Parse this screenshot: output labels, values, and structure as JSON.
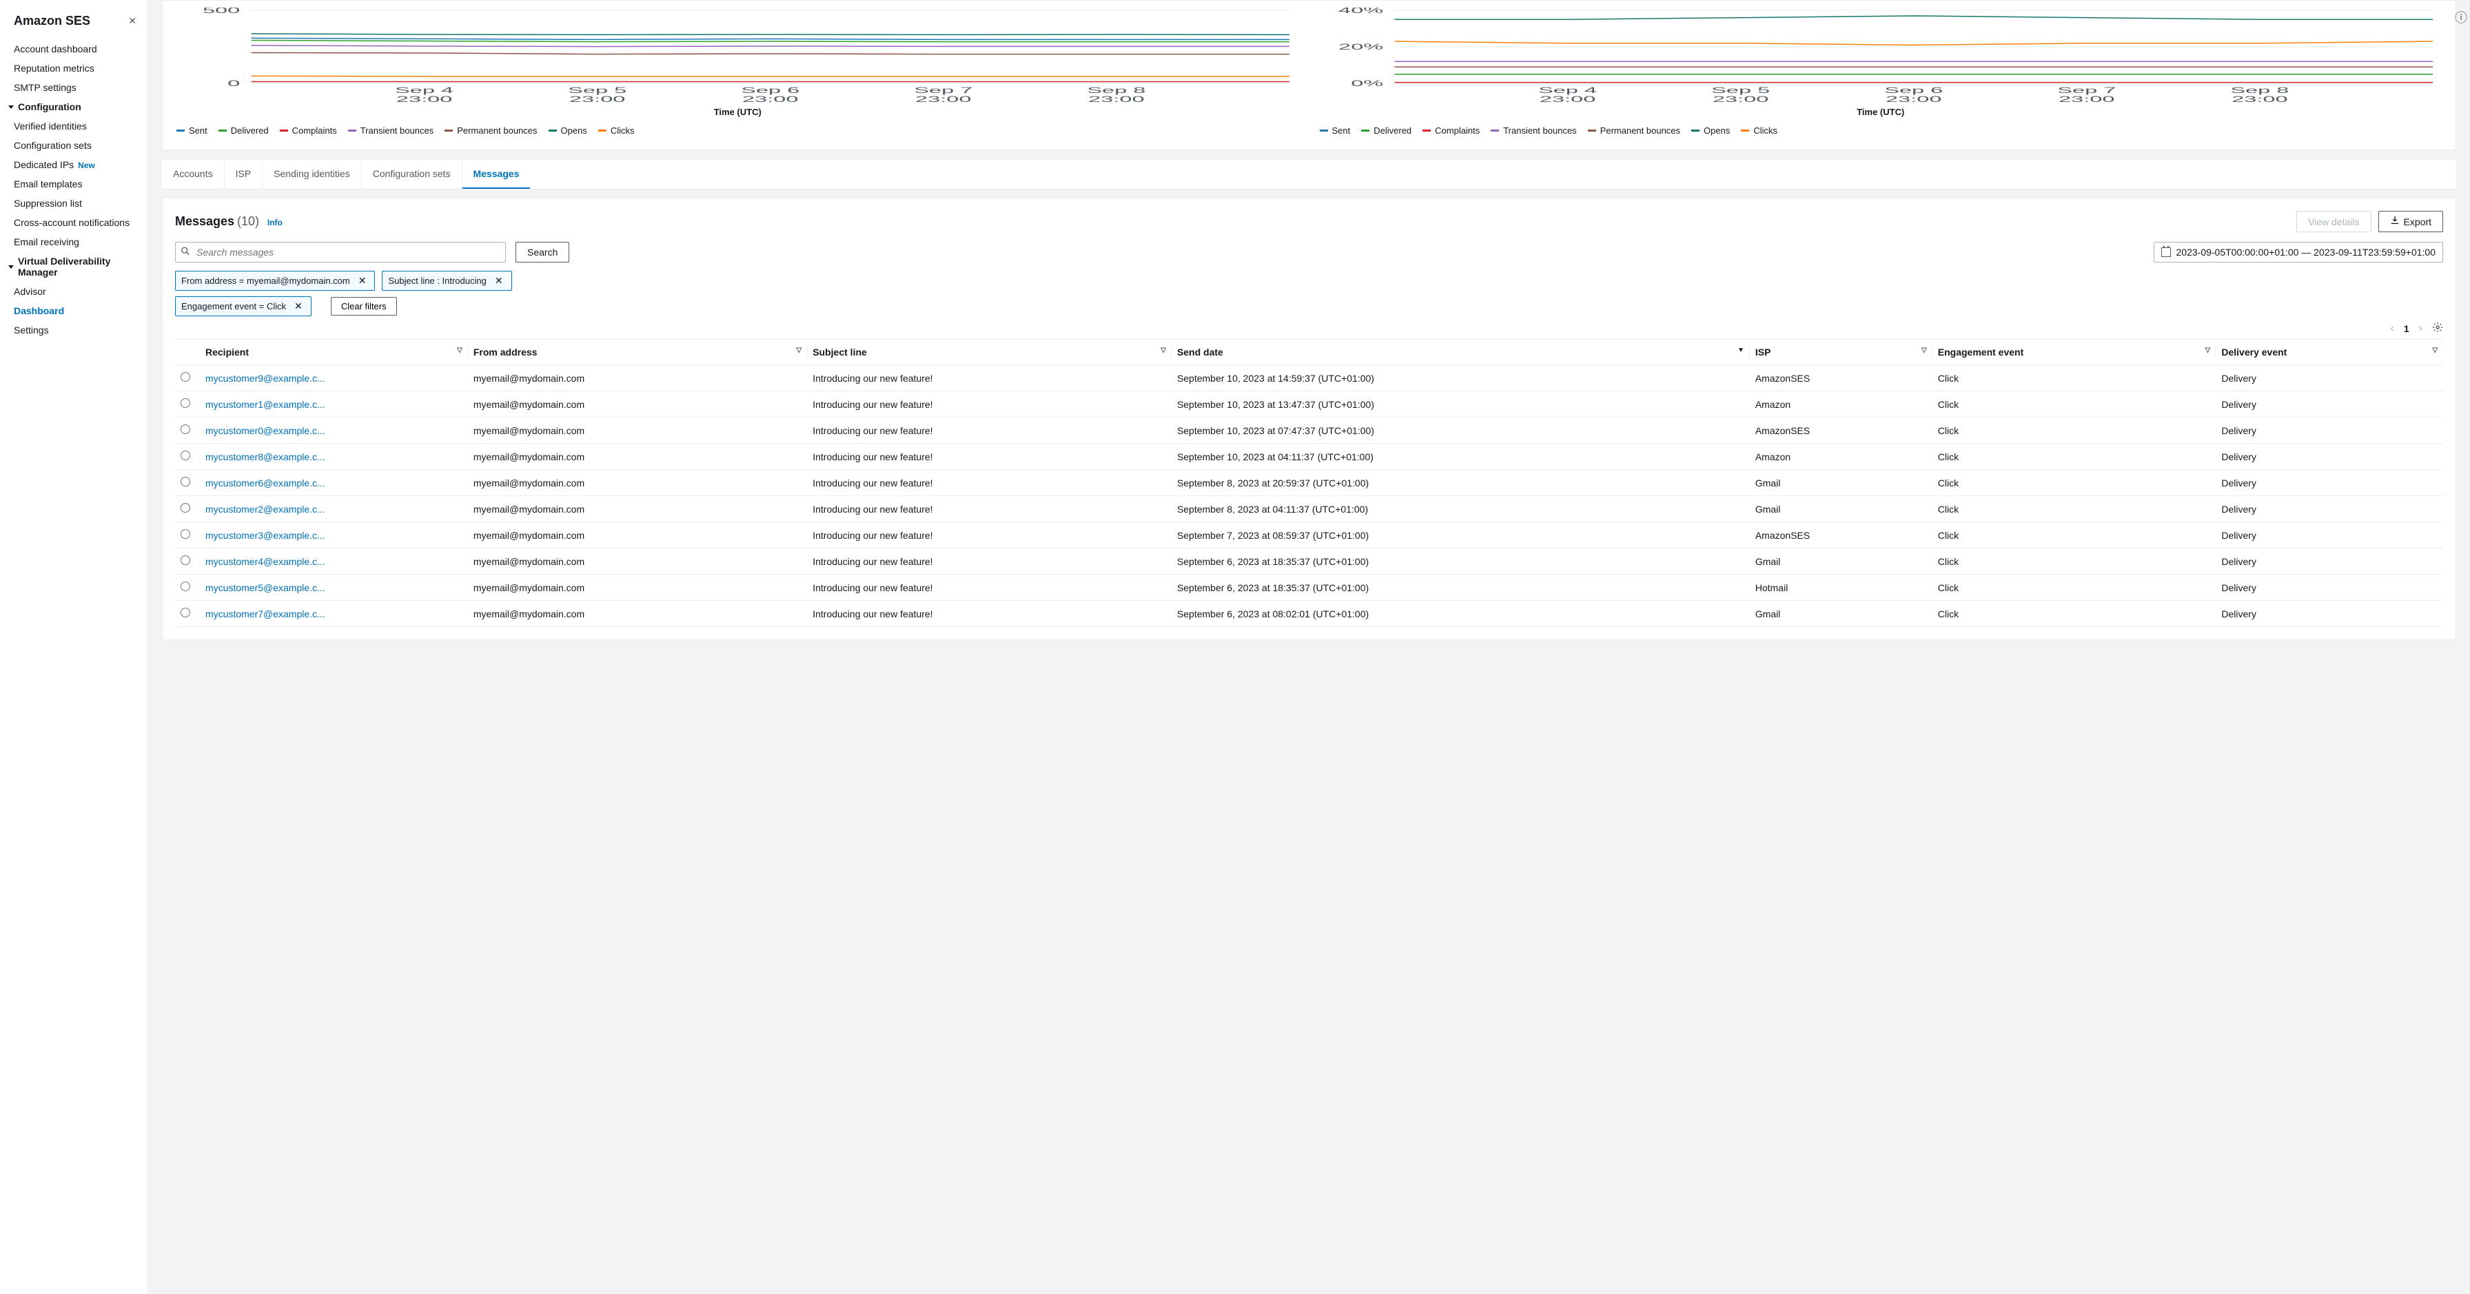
{
  "sidebar": {
    "title": "Amazon SES",
    "items_top": [
      "Account dashboard",
      "Reputation metrics",
      "SMTP settings"
    ],
    "config_section": {
      "header": "Configuration",
      "items": [
        "Verified identities",
        "Configuration sets",
        "Dedicated IPs",
        "Email templates",
        "Suppression list",
        "Cross-account notifications",
        "Email receiving"
      ],
      "new_badge_index": 2,
      "new_label": "New"
    },
    "vdm_section": {
      "header": "Virtual Deliverability Manager",
      "items": [
        "Advisor",
        "Dashboard",
        "Settings"
      ],
      "active_index": 1
    }
  },
  "charts": {
    "x_axis_label": "Time (UTC)",
    "x_ticks": [
      {
        "top": "Sep 4",
        "bottom": "23:00"
      },
      {
        "top": "Sep 5",
        "bottom": "23:00"
      },
      {
        "top": "Sep 6",
        "bottom": "23:00"
      },
      {
        "top": "Sep 7",
        "bottom": "23:00"
      },
      {
        "top": "Sep 8",
        "bottom": "23:00"
      }
    ],
    "left": {
      "y_ticks": [
        "0",
        "500"
      ]
    },
    "right": {
      "y_ticks": [
        "0%",
        "20%",
        "40%"
      ]
    },
    "legend": [
      {
        "label": "Sent",
        "color": "#1f77b4"
      },
      {
        "label": "Delivered",
        "color": "#2ca02c"
      },
      {
        "label": "Complaints",
        "color": "#d62728"
      },
      {
        "label": "Transient bounces",
        "color": "#9467bd"
      },
      {
        "label": "Permanent bounces",
        "color": "#8c564b"
      },
      {
        "label": "Opens",
        "color": "#17766c"
      },
      {
        "label": "Clicks",
        "color": "#ff7f0e"
      }
    ]
  },
  "chart_data": [
    {
      "type": "line",
      "title": "Volume",
      "xlabel": "Time (UTC)",
      "ylabel": "",
      "ylim": [
        0,
        500
      ],
      "x": [
        "Sep 4 00:00",
        "Sep 4 23:00",
        "Sep 5 23:00",
        "Sep 6 23:00",
        "Sep 7 23:00",
        "Sep 8 23:00",
        "Sep 9"
      ],
      "series": [
        {
          "name": "Sent",
          "values": [
            310,
            305,
            300,
            305,
            300,
            300,
            300
          ]
        },
        {
          "name": "Delivered",
          "values": [
            295,
            290,
            285,
            288,
            285,
            285,
            285
          ]
        },
        {
          "name": "Complaints",
          "values": [
            12,
            12,
            12,
            12,
            12,
            12,
            12
          ]
        },
        {
          "name": "Transient bounces",
          "values": [
            260,
            255,
            252,
            255,
            253,
            253,
            253
          ]
        },
        {
          "name": "Permanent bounces",
          "values": [
            210,
            208,
            200,
            203,
            200,
            200,
            200
          ]
        },
        {
          "name": "Opens",
          "values": [
            340,
            335,
            333,
            335,
            333,
            335,
            333
          ]
        },
        {
          "name": "Clicks",
          "values": [
            50,
            48,
            48,
            48,
            48,
            48,
            48
          ]
        }
      ]
    },
    {
      "type": "line",
      "title": "Rate",
      "xlabel": "Time (UTC)",
      "ylabel": "%",
      "ylim": [
        0,
        40
      ],
      "x": [
        "Sep 4 00:00",
        "Sep 4 23:00",
        "Sep 5 23:00",
        "Sep 6 23:00",
        "Sep 7 23:00",
        "Sep 8 23:00",
        "Sep 9"
      ],
      "series": [
        {
          "name": "Sent",
          "values": [
            5,
            5,
            5,
            5,
            5,
            5,
            5
          ]
        },
        {
          "name": "Delivered",
          "values": [
            5,
            5,
            5,
            5,
            5,
            5,
            5
          ]
        },
        {
          "name": "Complaints",
          "values": [
            0.5,
            0.5,
            0.5,
            0.5,
            0.5,
            0.5,
            0.5
          ]
        },
        {
          "name": "Transient bounces",
          "values": [
            12,
            12,
            12,
            12,
            12,
            12,
            12
          ]
        },
        {
          "name": "Permanent bounces",
          "values": [
            9,
            9,
            9,
            9,
            9,
            9,
            9
          ]
        },
        {
          "name": "Opens",
          "values": [
            35,
            35,
            36,
            37,
            36,
            35,
            35
          ]
        },
        {
          "name": "Clicks",
          "values": [
            23,
            22,
            22,
            21,
            22,
            22,
            23
          ]
        }
      ]
    }
  ],
  "tabs": [
    "Accounts",
    "ISP",
    "Sending identities",
    "Configuration sets",
    "Messages"
  ],
  "active_tab_index": 4,
  "messages": {
    "title": "Messages",
    "count_text": "(10)",
    "info": "Info",
    "view_details": "View details",
    "export": "Export",
    "search_placeholder": "Search messages",
    "search_button": "Search",
    "date_range": "2023-09-05T00:00:00+01:00 — 2023-09-11T23:59:59+01:00",
    "filters_1": [
      "From address = myemail@mydomain.com",
      "Subject line : Introducing"
    ],
    "filters_2": [
      "Engagement event = Click"
    ],
    "clear_filters": "Clear filters",
    "page": "1",
    "columns": [
      "Recipient",
      "From address",
      "Subject line",
      "Send date",
      "ISP",
      "Engagement event",
      "Delivery event"
    ],
    "rows": [
      {
        "recipient": "mycustomer9@example.c...",
        "from": "myemail@mydomain.com",
        "subject": "Introducing our new feature!",
        "send": "September 10, 2023 at 14:59:37 (UTC+01:00)",
        "isp": "AmazonSES",
        "eng": "Click",
        "del": "Delivery"
      },
      {
        "recipient": "mycustomer1@example.c...",
        "from": "myemail@mydomain.com",
        "subject": "Introducing our new feature!",
        "send": "September 10, 2023 at 13:47:37 (UTC+01:00)",
        "isp": "Amazon",
        "eng": "Click",
        "del": "Delivery"
      },
      {
        "recipient": "mycustomer0@example.c...",
        "from": "myemail@mydomain.com",
        "subject": "Introducing our new feature!",
        "send": "September 10, 2023 at 07:47:37 (UTC+01:00)",
        "isp": "AmazonSES",
        "eng": "Click",
        "del": "Delivery"
      },
      {
        "recipient": "mycustomer8@example.c...",
        "from": "myemail@mydomain.com",
        "subject": "Introducing our new feature!",
        "send": "September 10, 2023 at 04:11:37 (UTC+01:00)",
        "isp": "Amazon",
        "eng": "Click",
        "del": "Delivery"
      },
      {
        "recipient": "mycustomer6@example.c...",
        "from": "myemail@mydomain.com",
        "subject": "Introducing our new feature!",
        "send": "September 8, 2023 at 20:59:37 (UTC+01:00)",
        "isp": "Gmail",
        "eng": "Click",
        "del": "Delivery"
      },
      {
        "recipient": "mycustomer2@example.c...",
        "from": "myemail@mydomain.com",
        "subject": "Introducing our new feature!",
        "send": "September 8, 2023 at 04:11:37 (UTC+01:00)",
        "isp": "Gmail",
        "eng": "Click",
        "del": "Delivery"
      },
      {
        "recipient": "mycustomer3@example.c...",
        "from": "myemail@mydomain.com",
        "subject": "Introducing our new feature!",
        "send": "September 7, 2023 at 08:59:37 (UTC+01:00)",
        "isp": "AmazonSES",
        "eng": "Click",
        "del": "Delivery"
      },
      {
        "recipient": "mycustomer4@example.c...",
        "from": "myemail@mydomain.com",
        "subject": "Introducing our new feature!",
        "send": "September 6, 2023 at 18:35:37 (UTC+01:00)",
        "isp": "Gmail",
        "eng": "Click",
        "del": "Delivery"
      },
      {
        "recipient": "mycustomer5@example.c...",
        "from": "myemail@mydomain.com",
        "subject": "Introducing our new feature!",
        "send": "September 6, 2023 at 18:35:37 (UTC+01:00)",
        "isp": "Hotmail",
        "eng": "Click",
        "del": "Delivery"
      },
      {
        "recipient": "mycustomer7@example.c...",
        "from": "myemail@mydomain.com",
        "subject": "Introducing our new feature!",
        "send": "September 6, 2023 at 08:02:01 (UTC+01:00)",
        "isp": "Gmail",
        "eng": "Click",
        "del": "Delivery"
      }
    ]
  }
}
